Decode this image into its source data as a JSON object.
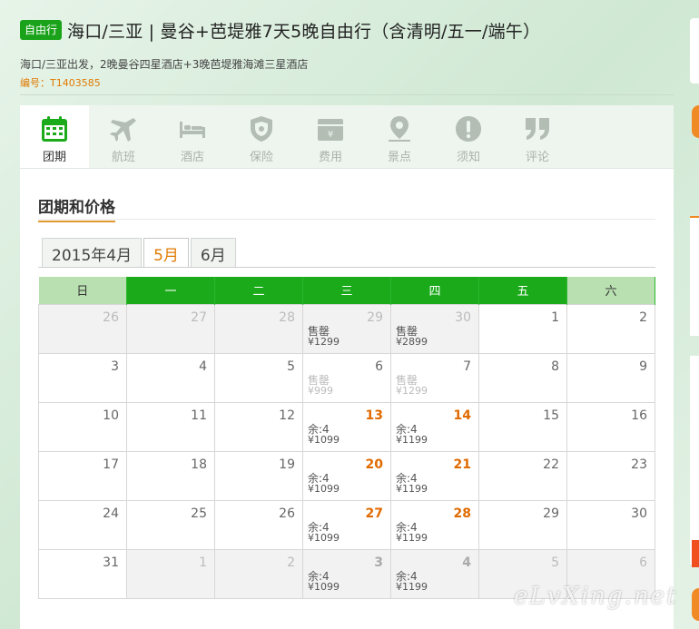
{
  "header": {
    "badge": "自由行",
    "title": "海口/三亚 | 曼谷+芭堤雅7天5晚自由行（含清明/五一/端午）",
    "subtitle": "海口/三亚出发，2晚曼谷四星酒店+3晚芭堤雅海滩三星酒店",
    "code_label": "编号：",
    "code_value": "T1403585"
  },
  "tabs": [
    {
      "label": "团期",
      "icon": "calendar-icon"
    },
    {
      "label": "航班",
      "icon": "airplane-icon"
    },
    {
      "label": "酒店",
      "icon": "bed-icon"
    },
    {
      "label": "保险",
      "icon": "shield-icon"
    },
    {
      "label": "费用",
      "icon": "wallet-yen-icon"
    },
    {
      "label": "景点",
      "icon": "location-pin-icon"
    },
    {
      "label": "须知",
      "icon": "warning-icon"
    },
    {
      "label": "评论",
      "icon": "quote-icon"
    }
  ],
  "section_title": "团期和价格",
  "month_tabs": [
    "2015年4月",
    "5月",
    "6月"
  ],
  "weekdays": [
    "日",
    "一",
    "二",
    "三",
    "四",
    "五",
    "六"
  ],
  "calendar": [
    [
      {
        "d": "26",
        "dim": true
      },
      {
        "d": "27",
        "dim": true
      },
      {
        "d": "28",
        "dim": true
      },
      {
        "d": "29",
        "dim": true,
        "s1": "售罄",
        "s2": "¥1299"
      },
      {
        "d": "30",
        "dim": true,
        "s1": "售罄",
        "s2": "¥2899"
      },
      {
        "d": "1"
      },
      {
        "d": "2"
      }
    ],
    [
      {
        "d": "3"
      },
      {
        "d": "4"
      },
      {
        "d": "5"
      },
      {
        "d": "6",
        "s1": "售罄",
        "s2": "¥999",
        "faded": true
      },
      {
        "d": "7",
        "s1": "售罄",
        "s2": "¥1299",
        "faded": true
      },
      {
        "d": "8"
      },
      {
        "d": "9"
      }
    ],
    [
      {
        "d": "10"
      },
      {
        "d": "11"
      },
      {
        "d": "12"
      },
      {
        "d": "13",
        "avail": true,
        "s1": "余:4",
        "s2": "¥1099"
      },
      {
        "d": "14",
        "avail": true,
        "s1": "余:4",
        "s2": "¥1199"
      },
      {
        "d": "15"
      },
      {
        "d": "16"
      }
    ],
    [
      {
        "d": "17"
      },
      {
        "d": "18"
      },
      {
        "d": "19"
      },
      {
        "d": "20",
        "avail": true,
        "s1": "余:4",
        "s2": "¥1099"
      },
      {
        "d": "21",
        "avail": true,
        "s1": "余:4",
        "s2": "¥1199"
      },
      {
        "d": "22"
      },
      {
        "d": "23"
      }
    ],
    [
      {
        "d": "24"
      },
      {
        "d": "25"
      },
      {
        "d": "26"
      },
      {
        "d": "27",
        "avail": true,
        "s1": "余:4",
        "s2": "¥1099"
      },
      {
        "d": "28",
        "avail": true,
        "s1": "余:4",
        "s2": "¥1199"
      },
      {
        "d": "29"
      },
      {
        "d": "30"
      }
    ],
    [
      {
        "d": "31"
      },
      {
        "d": "1",
        "dim": true
      },
      {
        "d": "2",
        "dim": true
      },
      {
        "d": "3",
        "dim": true,
        "avail": true,
        "s1": "余:4",
        "s2": "¥1099"
      },
      {
        "d": "4",
        "dim": true,
        "avail": true,
        "s1": "余:4",
        "s2": "¥1199"
      },
      {
        "d": "5",
        "dim": true
      },
      {
        "d": "6",
        "dim": true
      }
    ]
  ],
  "watermark": "eLvXing.net",
  "colors": {
    "accent_green": "#1aaa1a",
    "accent_orange": "#e07a00",
    "weekend_header": "#b9e0b1"
  }
}
